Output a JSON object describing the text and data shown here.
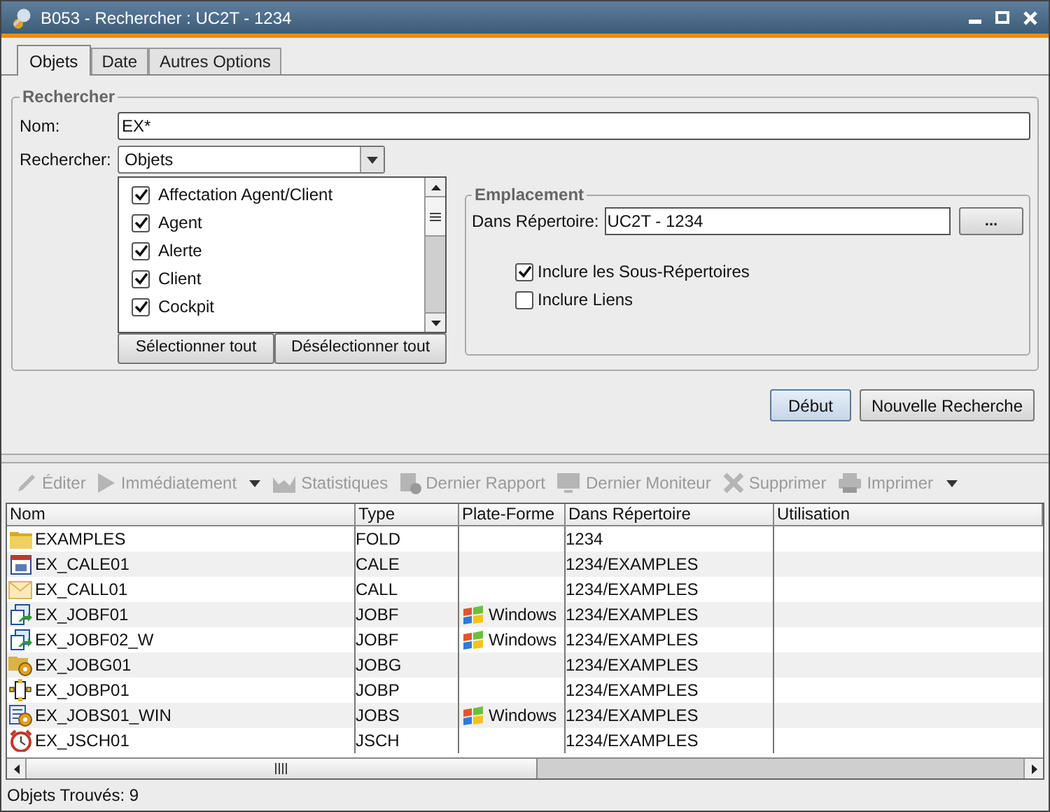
{
  "window": {
    "title": "B053 - Rechercher : UC2T - 1234"
  },
  "tabs": [
    {
      "label": "Objets",
      "selected": true
    },
    {
      "label": "Date",
      "selected": false
    },
    {
      "label": "Autres Options",
      "selected": false
    }
  ],
  "search": {
    "legend": "Rechercher",
    "name_label": "Nom:",
    "name_value": "EX*",
    "type_label": "Rechercher:",
    "type_value": "Objets",
    "object_types": [
      {
        "label": "Affectation Agent/Client",
        "checked": true
      },
      {
        "label": "Agent",
        "checked": true
      },
      {
        "label": "Alerte",
        "checked": true
      },
      {
        "label": "Client",
        "checked": true
      },
      {
        "label": "Cockpit",
        "checked": true
      }
    ],
    "select_all": "Sélectionner tout",
    "deselect_all": "Désélectionner tout"
  },
  "location": {
    "legend": "Emplacement",
    "folder_label": "Dans Répertoire:",
    "folder_value": "UC2T - 1234",
    "browse": "...",
    "options": [
      {
        "label": "Inclure les Sous-Répertoires",
        "checked": true
      },
      {
        "label": "Inclure Liens",
        "checked": false
      }
    ]
  },
  "actions": [
    "Début",
    "Nouvelle Recherche"
  ],
  "toolbar": [
    {
      "kind": "edit",
      "label": "Éditer",
      "disabled": true,
      "dropdown": false
    },
    {
      "kind": "run",
      "label": "Immédiatement",
      "disabled": true,
      "dropdown": true
    },
    {
      "kind": "stats",
      "label": "Statistiques",
      "disabled": true,
      "dropdown": false
    },
    {
      "kind": "report",
      "label": "Dernier Rapport",
      "disabled": true,
      "dropdown": false
    },
    {
      "kind": "monitor",
      "label": "Dernier Moniteur",
      "disabled": true,
      "dropdown": false
    },
    {
      "kind": "delete",
      "label": "Supprimer",
      "disabled": true,
      "dropdown": false
    },
    {
      "kind": "print",
      "label": "Imprimer",
      "disabled": true,
      "dropdown": true
    }
  ],
  "table": {
    "columns": [
      "Nom",
      "Type",
      "Plate-Forme",
      "Dans Répertoire",
      "Utilisation"
    ],
    "rows": [
      {
        "kind": "folder",
        "name": "EXAMPLES",
        "type": "FOLD",
        "folder": "1234"
      },
      {
        "kind": "calendar",
        "name": "EX_CALE01",
        "type": "CALE",
        "folder": "1234/EXAMPLES"
      },
      {
        "kind": "mail",
        "name": "EX_CALL01",
        "type": "CALL",
        "folder": "1234/EXAMPLES"
      },
      {
        "kind": "job",
        "name": "EX_JOBF01",
        "type": "JOBF",
        "platform": "Windows",
        "folder": "1234/EXAMPLES"
      },
      {
        "kind": "job",
        "name": "EX_JOBF02_W",
        "type": "JOBF",
        "platform": "Windows",
        "folder": "1234/EXAMPLES"
      },
      {
        "kind": "group",
        "name": "EX_JOBG01",
        "type": "JOBG",
        "folder": "1234/EXAMPLES"
      },
      {
        "kind": "plan",
        "name": "EX_JOBP01",
        "type": "JOBP",
        "folder": "1234/EXAMPLES"
      },
      {
        "kind": "script",
        "name": "EX_JOBS01_WIN",
        "type": "JOBS",
        "platform": "Windows",
        "folder": "1234/EXAMPLES"
      },
      {
        "kind": "schedule",
        "name": "EX_JSCH01",
        "type": "JSCH",
        "folder": "1234/EXAMPLES"
      }
    ]
  },
  "status_bar": "Objets Trouvés: 9"
}
